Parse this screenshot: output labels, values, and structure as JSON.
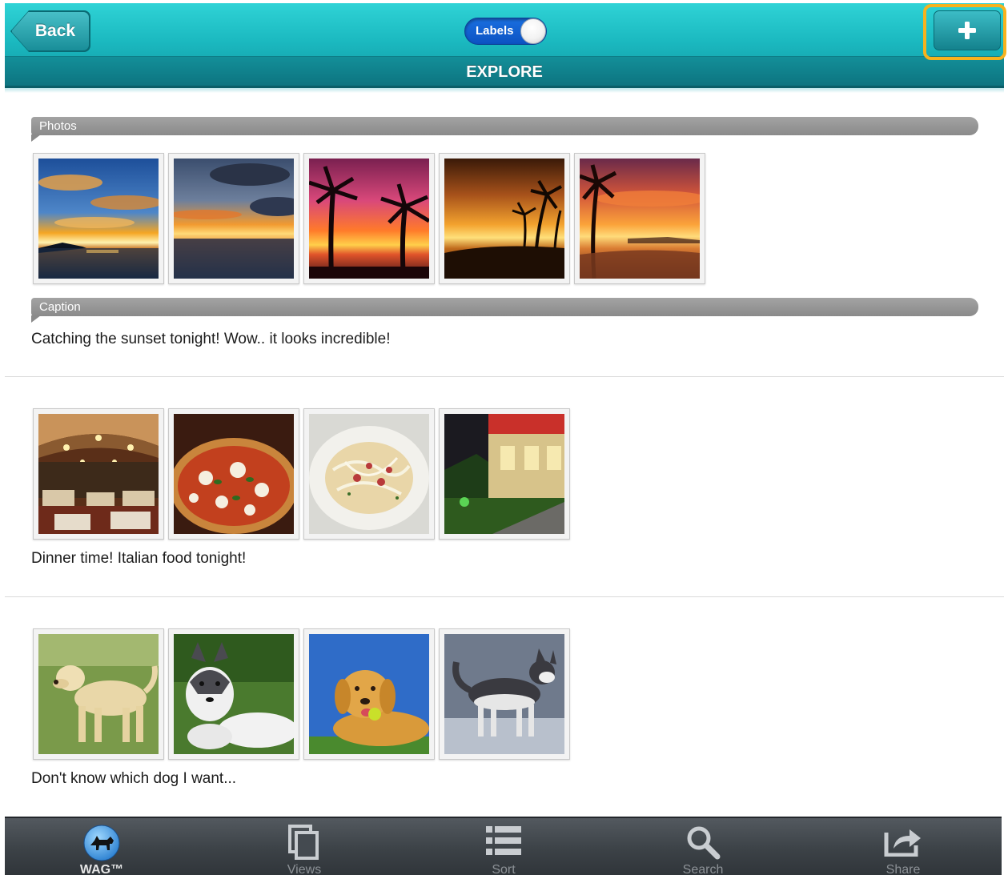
{
  "header": {
    "back_label": "Back",
    "toggle_label": "Labels",
    "title": "EXPLORE",
    "add_icon": "plus-icon",
    "accent_color": "#1bb9c0",
    "highlight_color": "#f7b21d"
  },
  "sections": {
    "photos_label": "Photos",
    "caption_label": "Caption"
  },
  "posts": [
    {
      "caption": "Catching the sunset tonight! Wow.. it looks incredible!",
      "photos": [
        "sunset-clouds",
        "sunset-ocean",
        "palm-sunset-pink",
        "palm-beach-sunset",
        "palm-shore-sunset"
      ]
    },
    {
      "caption": "Dinner time! Italian food tonight!",
      "photos": [
        "restaurant-interior",
        "pizza",
        "pasta-plate",
        "restaurant-patio"
      ]
    },
    {
      "caption": "Don't know which dog I want...",
      "photos": [
        "yellow-labrador",
        "husky-lying",
        "golden-retriever",
        "husky-standing"
      ]
    }
  ],
  "tabbar": {
    "items": [
      {
        "label": "WAG™",
        "icon": "dog-logo-icon",
        "active": true
      },
      {
        "label": "Views",
        "icon": "views-icon",
        "active": false
      },
      {
        "label": "Sort",
        "icon": "list-icon",
        "active": false
      },
      {
        "label": "Search",
        "icon": "search-icon",
        "active": false
      },
      {
        "label": "Share",
        "icon": "share-icon",
        "active": false
      }
    ]
  }
}
